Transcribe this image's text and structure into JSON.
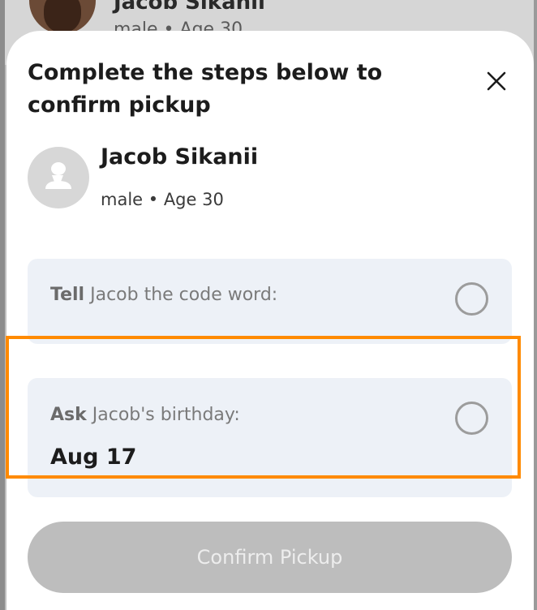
{
  "background": {
    "name": "Jacob Sikanii",
    "meta": "male • Age 30"
  },
  "sheet": {
    "title": "Complete the steps below to confirm pickup",
    "close_icon": "close-icon"
  },
  "person": {
    "avatar_icon": "user-placeholder-icon",
    "name": "Jacob Sikanii",
    "meta": "male • Age 30"
  },
  "steps": [
    {
      "action": "Tell",
      "text": "Jacob the code word:",
      "value": "",
      "checked": false
    },
    {
      "action": "Ask",
      "text": "Jacob's birthday:",
      "value": "Aug 17",
      "checked": false
    }
  ],
  "highlight_color": "#ff8a00",
  "confirm_button": {
    "label": "Confirm Pickup",
    "enabled": false
  }
}
